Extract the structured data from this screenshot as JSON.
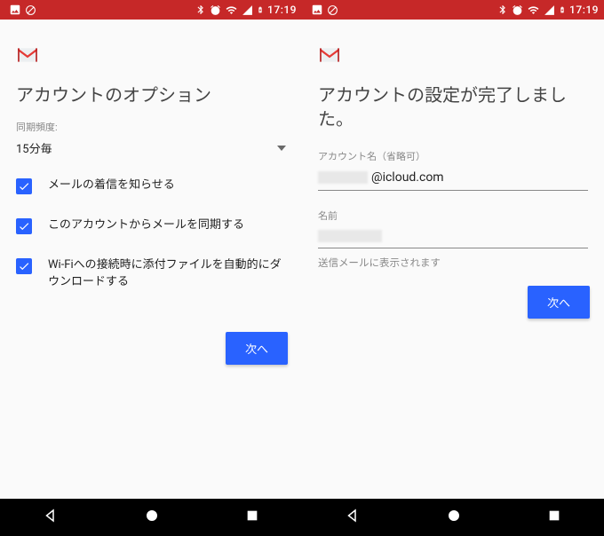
{
  "status": {
    "time": "17:19"
  },
  "left": {
    "title": "アカウントのオプション",
    "sync_caption": "同期頻度:",
    "sync_value": "15分毎",
    "options": [
      {
        "label": "メールの着信を知らせる",
        "checked": true
      },
      {
        "label": "このアカウントからメールを同期する",
        "checked": true
      },
      {
        "label": "Wi-Fiへの接続時に添付ファイルを自動的にダウンロードする",
        "checked": true
      }
    ],
    "next": "次へ"
  },
  "right": {
    "title": "アカウントの設定が完了しました。",
    "account_label": "アカウント名（省略可）",
    "account_value_suffix": "@icloud.com",
    "name_label": "名前",
    "name_value": "",
    "helper": "送信メールに表示されます",
    "next": "次へ"
  }
}
